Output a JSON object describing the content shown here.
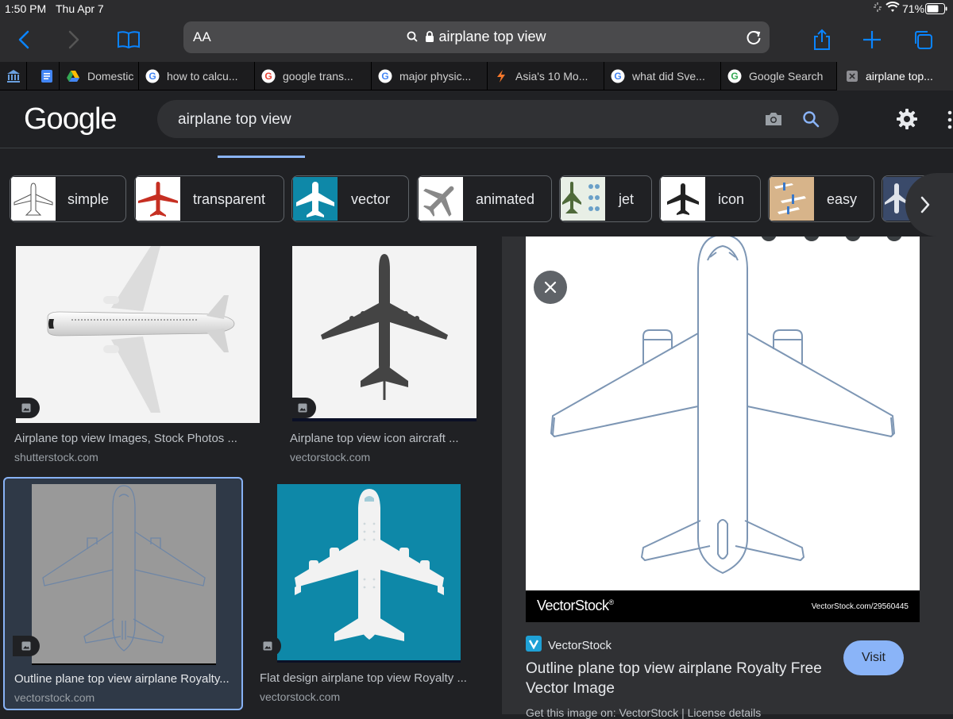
{
  "status": {
    "time": "1:50 PM",
    "date": "Thu Apr 7",
    "battery": "71%"
  },
  "browser": {
    "aa_label": "AA",
    "url": "airplane top view"
  },
  "tabs": [
    {
      "label": "",
      "icon": "bank-icon"
    },
    {
      "label": "",
      "icon": "google-docs-icon"
    },
    {
      "label": "Domestic",
      "icon": "google-drive-icon"
    },
    {
      "label": "how to calcu...",
      "icon": "google-icon"
    },
    {
      "label": "google trans...",
      "icon": "google-icon"
    },
    {
      "label": "major physic...",
      "icon": "google-icon"
    },
    {
      "label": "Asia's 10 Mo...",
      "icon": "bolt-icon"
    },
    {
      "label": "what did Sve...",
      "icon": "google-icon"
    },
    {
      "label": "Google Search",
      "icon": "google-icon"
    },
    {
      "label": "airplane top...",
      "icon": "close-icon"
    }
  ],
  "google": {
    "logo": "Google",
    "query": "airplane top view"
  },
  "chips": [
    {
      "label": "simple"
    },
    {
      "label": "transparent"
    },
    {
      "label": "vector"
    },
    {
      "label": "animated"
    },
    {
      "label": "jet"
    },
    {
      "label": "icon"
    },
    {
      "label": "easy"
    }
  ],
  "results": [
    {
      "title": "Airplane top view Images, Stock Photos ...",
      "source": "shutterstock.com"
    },
    {
      "title": "Airplane top view icon aircraft ...",
      "source": "vectorstock.com"
    },
    {
      "title": "Outline plane top view airplane Royalty...",
      "source": "vectorstock.com"
    },
    {
      "title": "Flat design airplane top view Royalty ...",
      "source": "vectorstock.com"
    }
  ],
  "panel": {
    "watermark": "VectorStock",
    "watermark_mark": "®",
    "image_id": "VectorStock.com/29560445",
    "source": "VectorStock",
    "title": "Outline plane top view airplane Royalty Free Vector Image",
    "visit_label": "Visit",
    "footer_text": "Get this image on: VectorStock | License details"
  },
  "colors": {
    "accent": "#8ab4f8",
    "background": "#202124",
    "teal": "#0e88a8"
  }
}
